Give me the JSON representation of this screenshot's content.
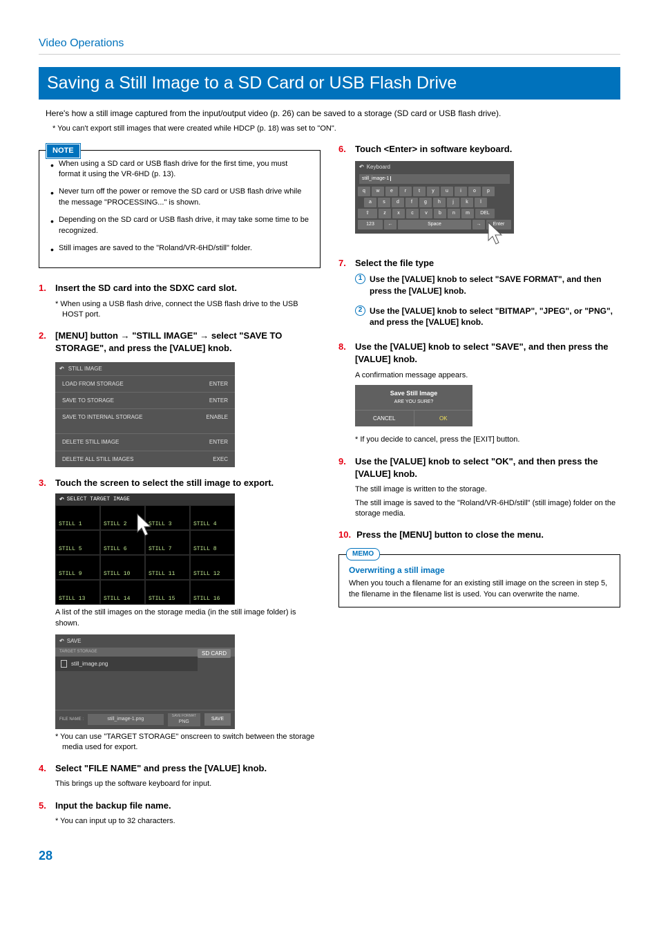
{
  "breadcrumb": "Video Operations",
  "title": "Saving a Still Image to a SD Card or USB Flash Drive",
  "intro": "Here's how a still image captured from the input/output video (p. 26) can be saved to a storage (SD card or USB flash drive).",
  "intro_note": "* You can't export still images that were created while HDCP (p. 18) was set to \"ON\".",
  "note": {
    "label": "NOTE",
    "items": [
      "When using a SD card or USB flash drive for the first time, you must format it using the VR-6HD (p. 13).",
      "Never turn off the power or remove the SD card or USB flash drive while the message \"PROCESSING...\" is shown.",
      "Depending on the SD card or USB flash drive, it may take some time to be recognized.",
      "Still images are saved to the \"Roland/VR-6HD/still\" folder."
    ]
  },
  "steps_left": {
    "s1": "Insert the SD card into the SDXC card slot.",
    "s1_note": "* When using a USB flash drive, connect the USB flash drive to the USB HOST port.",
    "s2": "[MENU] button → \"STILL IMAGE\" → select \"SAVE TO STORAGE\", and press the [VALUE] knob.",
    "s3": "Touch the screen to select the still image to export.",
    "s3_caption": "A list of the still images on the storage media (in the still image folder) is shown.",
    "s3_note": "* You can use \"TARGET STORAGE\" onscreen to switch between the storage media used for export.",
    "s4": "Select \"FILE NAME\" and press the [VALUE] knob.",
    "s4_caption": "This brings up the software keyboard for input.",
    "s5": "Input the backup file name.",
    "s5_note": "* You can input up to 32 characters."
  },
  "still_table": {
    "header": "STILL IMAGE",
    "rows": [
      [
        "LOAD FROM STORAGE",
        "ENTER"
      ],
      [
        "SAVE TO STORAGE",
        "ENTER"
      ],
      [
        "SAVE TO INTERNAL STORAGE",
        "ENABLE"
      ],
      [
        "DELETE STILL IMAGE",
        "ENTER"
      ],
      [
        "DELETE ALL STILL IMAGES",
        "EXEC"
      ]
    ]
  },
  "grid": {
    "header": "SELECT TARGET IMAGE",
    "cells": [
      "STILL 1",
      "STILL 2",
      "STILL 3",
      "STILL 4",
      "STILL 5",
      "STILL 6",
      "STILL 7",
      "STILL 8",
      "STILL 9",
      "STILL 10",
      "STILL 11",
      "STILL 12",
      "STILL 13",
      "STILL 14",
      "STILL 15",
      "STILL 16"
    ]
  },
  "save_panel": {
    "header": "SAVE",
    "target_label": "TARGET STORAGE",
    "sd": "SD CARD",
    "file_in_list": "still_image.png",
    "filename_label": "FILE NAME :",
    "filename_value": "still_image-1.png",
    "format_label": "SAVE FORMAT",
    "format_value": "PNG",
    "save_btn": "SAVE"
  },
  "steps_right": {
    "s6": "Touch <Enter> in software keyboard.",
    "s7": "Select the file type",
    "s7_a": "Use the [VALUE] knob to select \"SAVE FORMAT\", and then press the [VALUE] knob.",
    "s7_b": "Use the [VALUE] knob to select \"BITMAP\", \"JPEG\", or \"PNG\", and press the [VALUE] knob.",
    "s8": "Use the [VALUE] knob to select \"SAVE\", and then press the [VALUE] knob.",
    "s8_caption": "A confirmation message appears.",
    "s8_note": "* If you decide to cancel, press the [EXIT] button.",
    "s9": "Use the [VALUE] knob to select \"OK\", and then press the [VALUE] knob.",
    "s9_caption1": "The still image is written to the storage.",
    "s9_caption2": "The still image is saved to the \"Roland/VR-6HD/still\" (still image) folder on the storage media.",
    "s10": "Press the [MENU] button to close the menu."
  },
  "keyboard": {
    "header": "Keyboard",
    "input": "still_image-1",
    "row1": [
      "q",
      "w",
      "e",
      "r",
      "t",
      "y",
      "u",
      "i",
      "o",
      "p"
    ],
    "row2": [
      "a",
      "s",
      "d",
      "f",
      "g",
      "h",
      "j",
      "k",
      "l"
    ],
    "row3_shift": "⇧",
    "row3": [
      "z",
      "x",
      "c",
      "v",
      "b",
      "n",
      "m"
    ],
    "row3_del": "DEL",
    "row4_mode": "123",
    "row4_arrowL": "←",
    "row4_space": "Space",
    "row4_arrowR": "→",
    "row4_enter": "Enter"
  },
  "confirm": {
    "title": "Save Still Image",
    "sub": "ARE YOU SURE?",
    "cancel": "CANCEL",
    "ok": "OK"
  },
  "memo": {
    "label": "MEMO",
    "title": "Overwriting a still image",
    "body": "When you touch a filename for an existing still image on the screen in step 5, the filename in the filename list is used. You can overwrite the name."
  },
  "page": "28"
}
